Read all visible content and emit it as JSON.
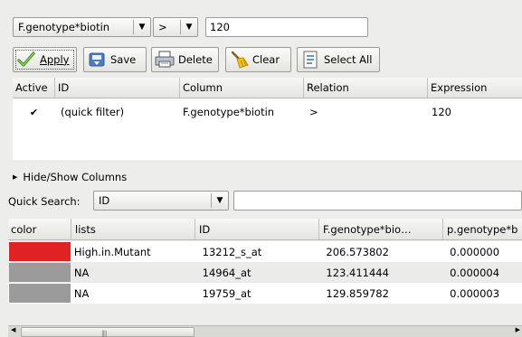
{
  "filter": {
    "column_combo": "F.genotype*biotin",
    "relation_combo": ">",
    "value": "120"
  },
  "actions": {
    "apply": "Apply",
    "save": "Save",
    "delete": "Delete",
    "clear": "Clear",
    "select_all": "Select All"
  },
  "filter_table": {
    "headers": [
      "Active",
      "ID",
      "Column",
      "Relation",
      "Expression"
    ],
    "rows": [
      {
        "active": "✔",
        "id": "(quick filter)",
        "column": "F.genotype*biotin",
        "relation": ">",
        "expression": "120"
      }
    ]
  },
  "hide_show": {
    "arrow": "▶",
    "label": "Hide/Show Columns"
  },
  "quick_search": {
    "label": "Quick Search:",
    "column": "ID",
    "value": ""
  },
  "data_table": {
    "headers": [
      "color",
      "lists",
      "ID",
      "F.genotype*bio…",
      "p.genotype*b"
    ],
    "rows": [
      {
        "color": "#e02222",
        "list": "High.in.Mutant",
        "id": "13212_s_at",
        "fval": "206.573802",
        "pval": "0.000000"
      },
      {
        "color": "#9b9b9b",
        "list": "NA",
        "id": "14964_at",
        "fval": "123.411444",
        "pval": "0.000004"
      },
      {
        "color": "#9b9b9b",
        "list": "NA",
        "id": "19759_at",
        "fval": "129.859782",
        "pval": "0.000003"
      }
    ]
  },
  "icons": {
    "combo_arrow": "▼",
    "scroll_left": "◀",
    "scroll_right": "▶",
    "grip": "||||"
  }
}
